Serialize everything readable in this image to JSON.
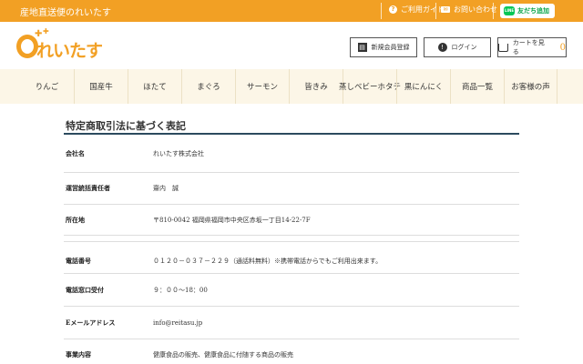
{
  "topbar": {
    "tagline": "産地直送便のれいたす",
    "guide_label": "ご利用ガイド",
    "contact_label": "お問い合わせ",
    "line_label": "友だち追加",
    "line_brand": "LINE"
  },
  "header": {
    "logo_text": "れいたす",
    "register_label": "新規会員登録",
    "login_label": "ログイン",
    "cart_label": "カートを見る",
    "cart_count": "0"
  },
  "nav": {
    "items": [
      {
        "label": "りんご"
      },
      {
        "label": "国産牛"
      },
      {
        "label": "ほたて"
      },
      {
        "label": "まぐろ"
      },
      {
        "label": "サーモン"
      },
      {
        "label": "皆きみ"
      },
      {
        "label": "蒸しベビーホタテ"
      },
      {
        "label": "黒にんにく"
      },
      {
        "label": "商品一覧"
      },
      {
        "label": "お客様の声"
      }
    ]
  },
  "page": {
    "title": "特定商取引法に基づく表記",
    "rows": [
      {
        "label": "会社名",
        "value": "れいたす株式会社"
      },
      {
        "label": "運営統括責任者",
        "value": "齋内　誠"
      },
      {
        "label": "所在地",
        "value": "〒810-0042 福岡県福岡市中央区赤坂一丁目14-22-7F"
      },
      {
        "label": "電話番号",
        "value": "０１２０－０３７－２２９（通話料無料）※携帯電話からでもご利用出来ます。"
      },
      {
        "label": "電話窓口受付",
        "value": "９：００～18：00"
      },
      {
        "label": "Eメールアドレス",
        "value": "info@reitasu.jp"
      },
      {
        "label": "事業内容",
        "value": "健康食品の販売、健康食品に付随する商品の販売"
      }
    ]
  },
  "colors": {
    "brand_orange": "#f2a024",
    "nav_bg": "#fcf6e7",
    "title_rule": "#2c4a5e",
    "line_green": "#06c755"
  }
}
